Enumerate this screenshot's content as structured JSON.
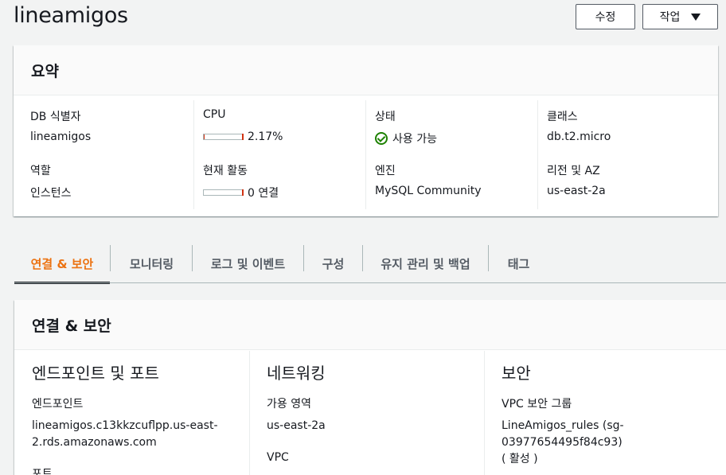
{
  "header": {
    "title": "lineamigos",
    "edit_label": "수정",
    "actions_label": "작업"
  },
  "summary": {
    "title": "요약",
    "db_id_label": "DB 식별자",
    "db_id_value": "lineamigos",
    "role_label": "역할",
    "role_value": "인스턴스",
    "cpu_label": "CPU",
    "cpu_value": "2.17%",
    "cpu_fraction": 0.0217,
    "activity_label": "현재 활동",
    "activity_value": "0 연결",
    "activity_fraction": 0,
    "status_label": "상태",
    "status_value": "사용 가능",
    "engine_label": "엔진",
    "engine_value": "MySQL Community",
    "class_label": "클래스",
    "class_value": "db.t2.micro",
    "region_label": "리전 및 AZ",
    "region_value": "us-east-2a",
    "status_color": "#1d8102"
  },
  "tabs": [
    {
      "label": "연결 & 보안",
      "active": true
    },
    {
      "label": "모니터링"
    },
    {
      "label": "로그 및 이벤트"
    },
    {
      "label": "구성"
    },
    {
      "label": "유지 관리 및 백업"
    },
    {
      "label": "태그"
    }
  ],
  "connectivity": {
    "title": "연결 & 보안",
    "endpoint_section": "엔드포인트 및 포트",
    "endpoint_label": "엔드포인트",
    "endpoint_value": "lineamigos.c13kkzcuflpp.us-east-2.rds.amazonaws.com",
    "port_label": "포트",
    "network_section": "네트워킹",
    "az_label": "가용 영역",
    "az_value": "us-east-2a",
    "vpc_label": "VPC",
    "security_section": "보안",
    "sg_label": "VPC 보안 그룹",
    "sg_value": "LineAmigos_rules (sg-03977654495f84c93)",
    "sg_status": "( 활성 )"
  },
  "colors": {
    "accent": "#ec7211",
    "link": "#0073bb",
    "success": "#1d8102",
    "bar_fill": "#d13212"
  }
}
